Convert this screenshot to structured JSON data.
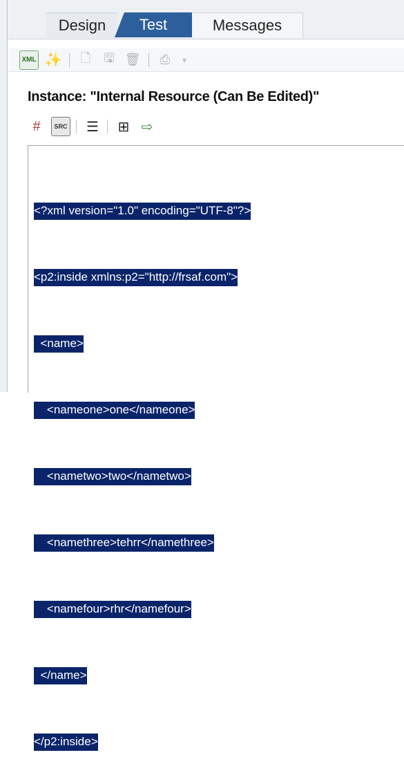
{
  "tabs": [
    {
      "label": "Design"
    },
    {
      "label": "Test"
    },
    {
      "label": "Messages"
    }
  ],
  "instance_title": "Instance: \"Internal Resource (Can Be Edited)\"",
  "toolbar1_icons": [
    "xml-icon",
    "wizard-icon",
    "new-document-icon",
    "save-icon",
    "delete-icon",
    "print-icon",
    "dropdown-arrow-icon"
  ],
  "toolbar2_icons": [
    "grid-icon",
    "src-icon",
    "outline-icon",
    "find-icon",
    "export-icon"
  ],
  "code_lines": [
    "<?xml version=\"1.0\" encoding=\"UTF-8\"?>",
    "<p2:inside xmlns:p2=\"http://frsaf.com\">",
    "  <name>",
    "    <nameone>one</nameone>",
    "    <nametwo>two</nametwo>",
    "    <namethree>tehrr</namethree>",
    "    <namefour>rhr</namefour>",
    "  </name>",
    "</p2:inside>"
  ],
  "colors": {
    "selection": "#0a246a",
    "active_tab": "#2e5f9d"
  }
}
